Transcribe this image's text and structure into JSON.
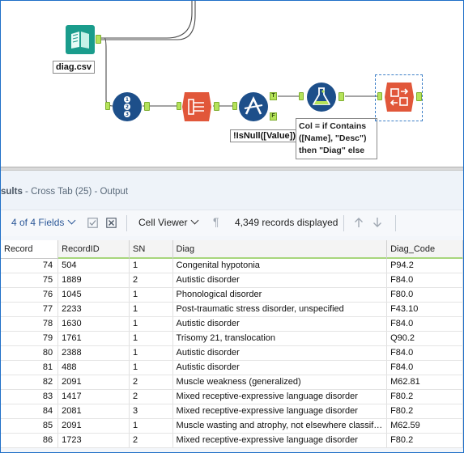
{
  "canvas": {
    "input_label": "diag.csv",
    "filter_label": "!IsNull([Value])",
    "filter_true_anchor": "T",
    "filter_false_anchor": "F",
    "formula_annotation": "Col = if Contains ([Name], \"Desc\") then \"Diag\" else \"Diag_Code\"",
    "recordid_icon": "record-id-icon",
    "transpose_icon": "transpose-icon",
    "filter_icon": "filter-icon",
    "formula_icon": "formula-flask-icon",
    "crosstab_icon": "cross-tab-icon",
    "input_icon": "book-input-icon",
    "colors": {
      "input_tool": "#1a9c8c",
      "recordid_tool": "#1d4f8a",
      "transform_tool": "#e1573a",
      "filter_tool": "#1d4f8a",
      "anchor": "#b5e35a"
    }
  },
  "results": {
    "title_prefix": "sults",
    "title_rest": " - Cross Tab (25) - Output",
    "fields_label": "4 of 4 Fields",
    "viewer_label": "Cell Viewer",
    "records_label": "4,349 records displayed"
  },
  "grid": {
    "headers": [
      "Record",
      "RecordID",
      "SN",
      "Diag",
      "Diag_Code"
    ],
    "rows": [
      [
        "74",
        "504",
        "1",
        "Congenital hypotonia",
        "P94.2"
      ],
      [
        "75",
        "1889",
        "2",
        "Autistic disorder",
        "F84.0"
      ],
      [
        "76",
        "1045",
        "1",
        "Phonological disorder",
        "F80.0"
      ],
      [
        "77",
        "2233",
        "1",
        "Post-traumatic stress disorder, unspecified",
        "F43.10"
      ],
      [
        "78",
        "1630",
        "1",
        "Autistic disorder",
        "F84.0"
      ],
      [
        "79",
        "1761",
        "1",
        "Trisomy 21, translocation",
        "Q90.2"
      ],
      [
        "80",
        "2388",
        "1",
        "Autistic disorder",
        "F84.0"
      ],
      [
        "81",
        "488",
        "1",
        "Autistic disorder",
        "F84.0"
      ],
      [
        "82",
        "2091",
        "2",
        "Muscle weakness (generalized)",
        "M62.81"
      ],
      [
        "83",
        "1417",
        "2",
        "Mixed receptive-expressive language disorder",
        "F80.2"
      ],
      [
        "84",
        "2081",
        "3",
        "Mixed receptive-expressive language disorder",
        "F80.2"
      ],
      [
        "85",
        "2091",
        "1",
        "Muscle wasting and atrophy, not elsewhere classified",
        "M62.59"
      ],
      [
        "86",
        "1723",
        "2",
        "Mixed receptive-expressive language disorder",
        "F80.2"
      ]
    ]
  }
}
